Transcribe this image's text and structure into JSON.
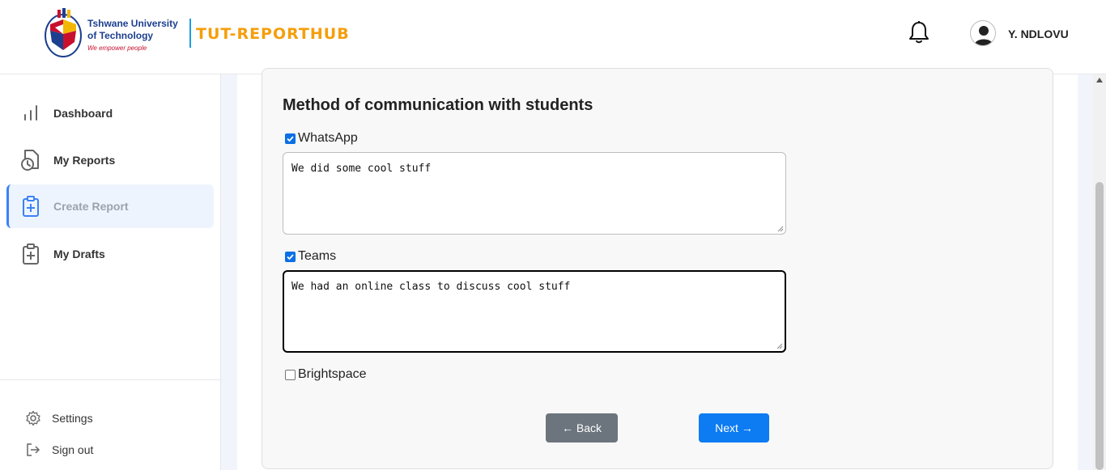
{
  "header": {
    "logo_line1": "Tshwane University",
    "logo_line2": "of Technology",
    "logo_tagline": "We empower people",
    "app_name": "TUT-REPORTHUB",
    "user_name": "Y. NDLOVU"
  },
  "sidebar": {
    "items": [
      {
        "label": "Dashboard",
        "icon": "bar-chart-icon"
      },
      {
        "label": "My Reports",
        "icon": "clock-document-icon"
      },
      {
        "label": "Create Report",
        "icon": "clipboard-plus-icon",
        "active": true
      },
      {
        "label": "My Drafts",
        "icon": "clipboard-plus-icon"
      }
    ],
    "bottom": [
      {
        "label": "Settings",
        "icon": "gear-icon"
      },
      {
        "label": "Sign out",
        "icon": "sign-out-icon"
      }
    ]
  },
  "form": {
    "section_title": "Method of communication with students",
    "options": [
      {
        "label": "WhatsApp",
        "checked": true,
        "text": "We did some cool stuff"
      },
      {
        "label": "Teams",
        "checked": true,
        "text": "We had an online class to discuss cool stuff"
      },
      {
        "label": "Brightspace",
        "checked": false
      }
    ],
    "back_label": "← Back",
    "next_label": "Next →"
  },
  "colors": {
    "brand": "#f59e0b",
    "primary": "#0d7bf2",
    "secondary": "#6c757d",
    "active_nav_bg": "#eef4fd"
  }
}
